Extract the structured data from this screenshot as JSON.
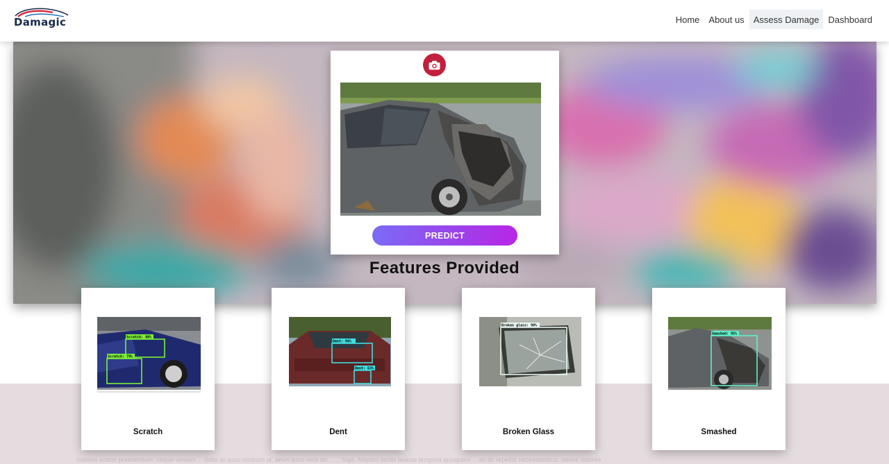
{
  "brand": {
    "name": "Damagic"
  },
  "nav": {
    "items": [
      {
        "label": "Home",
        "active": false
      },
      {
        "label": "About us",
        "active": false
      },
      {
        "label": "Assess Damage",
        "active": true
      },
      {
        "label": "Dashboard",
        "active": false
      }
    ]
  },
  "upload": {
    "camera_icon": "camera-icon",
    "predict_label": "PREDICT"
  },
  "features": {
    "title": "Features Provided",
    "cards": [
      {
        "label": "Scratch",
        "detections": [
          "Scratch: 88%",
          "Scratch: 79%"
        ]
      },
      {
        "label": "Dent",
        "detections": [
          "Dent: 96%",
          "Dent: 63%"
        ]
      },
      {
        "label": "Broken Glass",
        "detections": [
          "Broken glass: 98%"
        ]
      },
      {
        "label": "Smashed",
        "detections": [
          "Smashed: 95%"
        ]
      }
    ]
  },
  "footer": {
    "text": "nisimus autem praesentium, neque veniam ... dolor at quos nostrum ut, amet quos vero dic... ... fuga. Adipisci facilis beatae tempora quisquam ... as ab repellat necessitatibus, labore dolores"
  },
  "colors": {
    "accent_red": "#c11f3b",
    "predict_start": "#7b6cf6",
    "predict_end": "#b826e6",
    "scratch_box": "#7cf03a",
    "dent_box": "#3fdfe0",
    "glass_box": "#e8f4f0",
    "smashed_box": "#5ef0c8"
  }
}
